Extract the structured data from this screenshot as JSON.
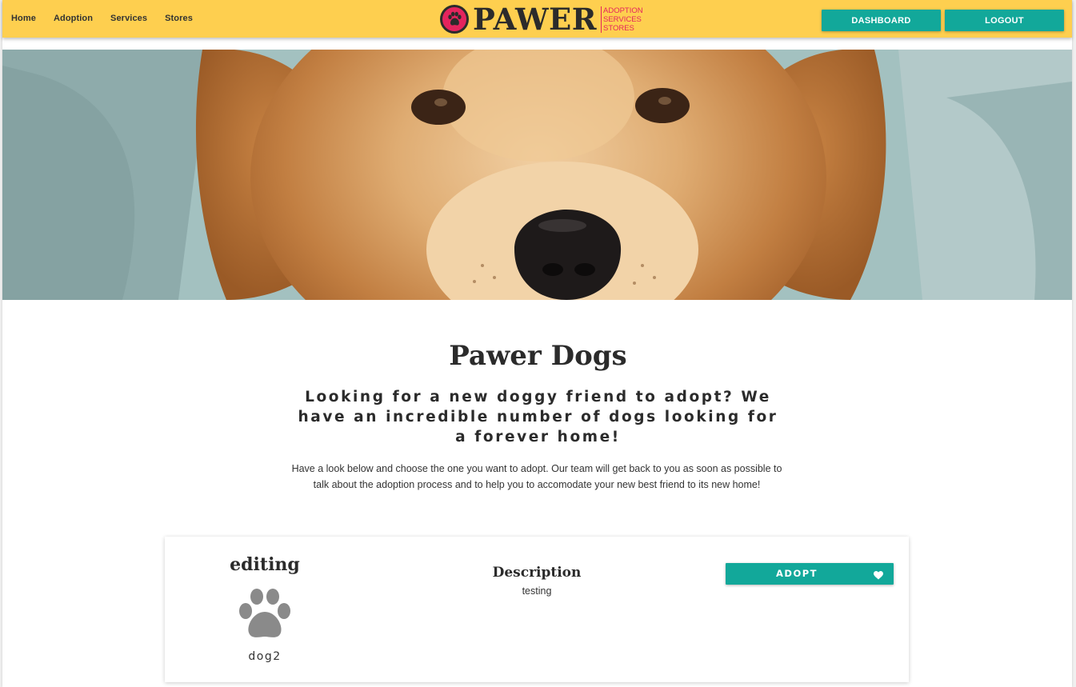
{
  "nav": {
    "links": [
      "Home",
      "Adoption",
      "Services",
      "Stores"
    ],
    "buttons": {
      "dashboard": "DASHBOARD",
      "logout": "LOGOUT"
    }
  },
  "logo": {
    "wordmark": "PAWER",
    "taglines": [
      "ADOPTION",
      "SERVICES",
      "STORES"
    ]
  },
  "hero": {
    "icon": "golden-retriever-photo"
  },
  "page": {
    "title": "Pawer Dogs",
    "subtitle": "Looking for a new doggy friend to adopt? We have an incredible number of dogs looking for a forever home!",
    "intro": "Have a look below and choose the one you want to adopt. Our team will get back to you as soon as possible to talk about the adoption process and to help you to accomodate your new best friend to its new home!"
  },
  "pet_card": {
    "name": "editing",
    "icon": "paw-icon",
    "id_label": "dog2",
    "description_heading": "Description",
    "description": "testing",
    "adopt_label": "ADOPT",
    "adopt_icon": "heart-icon"
  },
  "colors": {
    "navbar": "#fecf4f",
    "accent": "#12a89a",
    "brand": "#e4245d",
    "dark": "#2b2b2b"
  }
}
